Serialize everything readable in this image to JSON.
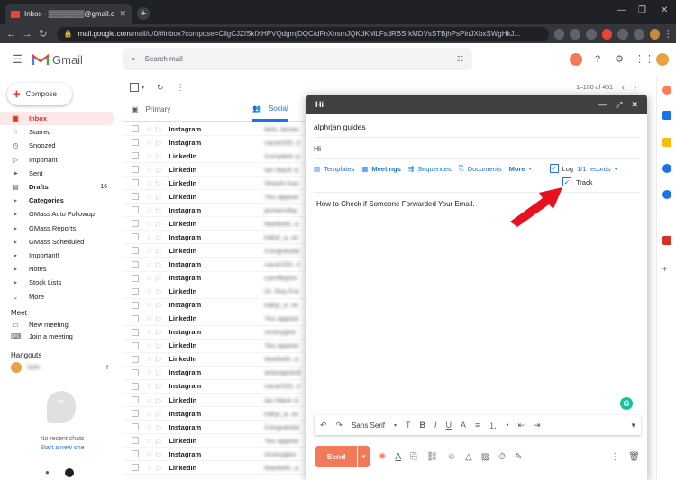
{
  "browser": {
    "tab_title": "Inbox - ▒▒▒▒▒▒▒@gmail.com",
    "url_host": "mail.google.com",
    "url_path": "/mail/u/0/#inbox?compose=CllgCJZfSkfXHPVQdgmjDQCfdFnXnsmJQKdKMLFsdRBSrkMDVsSTBjhPsPlnJXbxSWgHkJ..."
  },
  "gmail": {
    "logo_text": "Gmail",
    "search_placeholder": "Search mail",
    "compose_label": "Compose",
    "nav": [
      {
        "label": "Inbox",
        "icon": "inbox-icon",
        "active": true
      },
      {
        "label": "Starred",
        "icon": "star-icon"
      },
      {
        "label": "Snoozed",
        "icon": "clock-icon"
      },
      {
        "label": "Important",
        "icon": "important-icon"
      },
      {
        "label": "Sent",
        "icon": "send-icon"
      },
      {
        "label": "Drafts",
        "icon": "draft-icon",
        "count": "16",
        "bold": true
      },
      {
        "label": "Categories",
        "icon": "label-icon",
        "bold": true
      },
      {
        "label": "GMass Auto Followup",
        "icon": "label-icon"
      },
      {
        "label": "GMass Reports",
        "icon": "label-icon"
      },
      {
        "label": "GMass Scheduled",
        "icon": "label-icon"
      },
      {
        "label": "Important!",
        "icon": "label-icon"
      },
      {
        "label": "Notes",
        "icon": "label-icon"
      },
      {
        "label": "Stock Lists",
        "icon": "label-icon"
      },
      {
        "label": "More",
        "icon": "chevron-down-icon"
      }
    ],
    "meet": {
      "heading": "Meet",
      "new_meeting": "New meeting",
      "join_meeting": "Join a meeting"
    },
    "hangouts": {
      "heading": "Hangouts",
      "user": "Seth",
      "no_chats": "No recent chats",
      "start_chat": "Start a new one"
    },
    "list": {
      "pagination": "1–100 of 451",
      "tab_primary": "Primary",
      "tab_social": "Social"
    },
    "rows": [
      {
        "sender": "Instagram",
        "snippet": "bels, laman"
      },
      {
        "sender": "Instagram",
        "snippet": "cacar333, ch"
      },
      {
        "sender": "LinkedIn",
        "snippet": "Complete you"
      },
      {
        "sender": "LinkedIn",
        "snippet": "Ian Mack si"
      },
      {
        "sender": "LinkedIn",
        "snippet": "Shashi Kan"
      },
      {
        "sender": "LinkedIn",
        "snippet": "You appear"
      },
      {
        "sender": "Instagram",
        "snippet": "jenniersfay"
      },
      {
        "sender": "LinkedIn",
        "snippet": "Maribeth, a"
      },
      {
        "sender": "Instagram",
        "snippet": "kakyl_a, se"
      },
      {
        "sender": "LinkedIn",
        "snippet": "Congratulat"
      },
      {
        "sender": "Instagram",
        "snippet": "cacar333, ch"
      },
      {
        "sender": "Instagram",
        "snippet": "camilleptre"
      },
      {
        "sender": "LinkedIn",
        "snippet": "Dr. Roy Fre"
      },
      {
        "sender": "Instagram",
        "snippet": "kakyl_a, se"
      },
      {
        "sender": "LinkedIn",
        "snippet": "You appear"
      },
      {
        "sender": "Instagram",
        "snippet": "reveryglee"
      },
      {
        "sender": "LinkedIn",
        "snippet": "You appear"
      },
      {
        "sender": "LinkedIn",
        "snippet": "Maribeth, a"
      },
      {
        "sender": "Instagram",
        "snippet": "arianagrand"
      },
      {
        "sender": "Instagram",
        "snippet": "cacar333, ch"
      },
      {
        "sender": "LinkedIn",
        "snippet": "Ian Mack si"
      },
      {
        "sender": "Instagram",
        "snippet": "kakyl_a, se"
      },
      {
        "sender": "Instagram",
        "snippet": "Congratulat"
      },
      {
        "sender": "LinkedIn",
        "snippet": "You appear"
      },
      {
        "sender": "Instagram",
        "snippet": "reveryglee"
      },
      {
        "sender": "LinkedIn",
        "snippet": "Maribeth, a"
      }
    ]
  },
  "compose": {
    "window_title": "Hi",
    "to": "alphrjan guides",
    "subject": "Hi",
    "hub": {
      "templates": "Templates",
      "meetings": "Meetings",
      "sequences": "Sequences",
      "documents": "Documents",
      "more": "More",
      "log": "Log",
      "records": "1/1 records",
      "track": "Track"
    },
    "body": "How to Check if Someone Forwarded Your Email.",
    "font": "Sans Serif",
    "send": "Send"
  },
  "colors": {
    "accent": "#1a73e8",
    "send": "#f4785a",
    "arrow": "#e8111e"
  }
}
